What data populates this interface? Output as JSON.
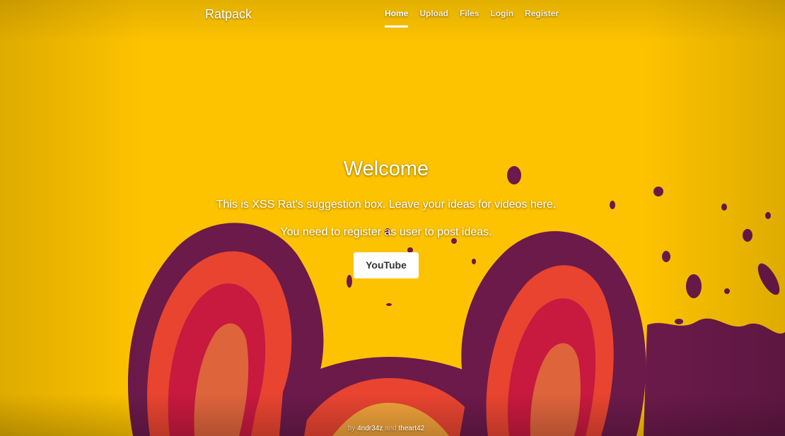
{
  "nav": {
    "brand": "Ratpack",
    "items": [
      {
        "label": "Home",
        "active": true
      },
      {
        "label": "Upload",
        "active": false
      },
      {
        "label": "Files",
        "active": false
      },
      {
        "label": "Login",
        "active": false
      },
      {
        "label": "Register",
        "active": false
      }
    ]
  },
  "hero": {
    "title": "Welcome",
    "lead1": "This is XSS Rat's suggestion box. Leave your ideas for videos here.",
    "lead2": "You need to register as user to post ideas.",
    "button": "YouTube"
  },
  "footer": {
    "by": "by",
    "author1": "4ndr34z",
    "and": "and",
    "author2": "theart42"
  },
  "colors": {
    "background": "#fdc300",
    "ear_outer": "#6b1a4a",
    "ear_mid": "#e84430",
    "ear_inner": "#c8193f",
    "accent": "#ffffff"
  },
  "background_art": "cartoon-rat-ears-illustration"
}
